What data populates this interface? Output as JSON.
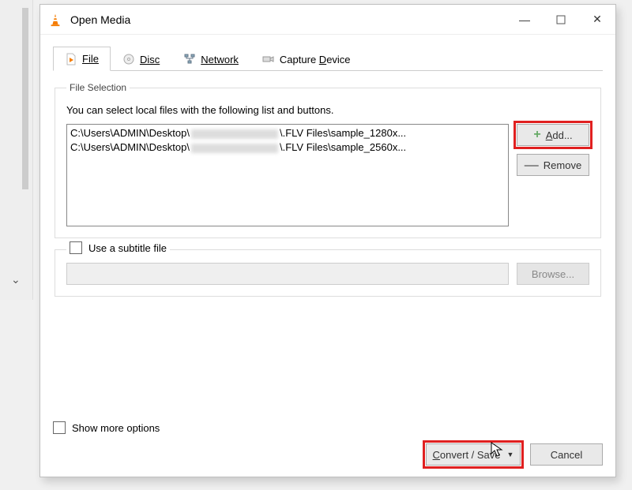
{
  "window": {
    "title": "Open Media"
  },
  "tabs": {
    "file": "File",
    "disc": "Disc",
    "network": "Network",
    "capture": "Capture Device"
  },
  "fileSelection": {
    "legend": "File Selection",
    "hint": "You can select local files with the following list and buttons.",
    "files": [
      {
        "prefix": "C:\\Users\\ADMIN\\Desktop\\",
        "suffix": "\\.FLV Files\\sample_1280x..."
      },
      {
        "prefix": "C:\\Users\\ADMIN\\Desktop\\",
        "suffix": "\\.FLV Files\\sample_2560x..."
      }
    ],
    "addLabel": "Add...",
    "removeLabel": "Remove"
  },
  "subtitle": {
    "checkboxLabel": "Use a subtitle file",
    "browseLabel": "Browse..."
  },
  "footer": {
    "showMore": "Show more options",
    "convertSave": "Convert / Save",
    "cancel": "Cancel"
  }
}
